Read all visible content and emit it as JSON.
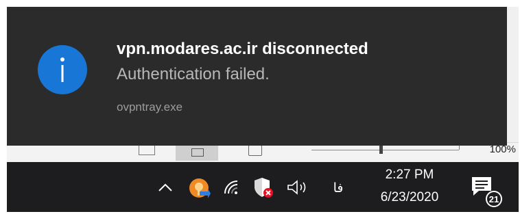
{
  "toast": {
    "icon": "info-icon",
    "title": "vpn.modares.ac.ir disconnected",
    "message": "Authentication failed.",
    "source": "ovpntray.exe",
    "background": "#2b2b2b",
    "accent": "#1877d6"
  },
  "statusbar": {
    "zoom": "100%",
    "icons": [
      "read-mode-icon",
      "print-layout-icon",
      "web-layout-icon"
    ]
  },
  "taskbar": {
    "tray_icons": [
      "chevron-up-icon",
      "openvpn-gui-icon",
      "wifi-icon",
      "security-shield-icon",
      "speaker-icon"
    ],
    "language": "فا",
    "time": "2:27 PM",
    "date": "6/23/2020",
    "notification_count": "21",
    "background": "#1d1d1f"
  }
}
